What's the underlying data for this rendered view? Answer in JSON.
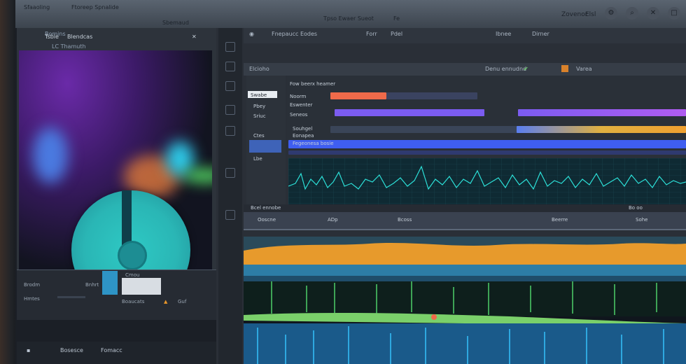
{
  "topbar": {
    "menu1": "Sfaaoling",
    "menu2": "Ftoreep Spnalide",
    "menu3": "Sbemaud",
    "title": "Tpso Ewaer Sueot",
    "menu4": "Fe",
    "right_label": "Zovenor",
    "right_label2": "Elsl"
  },
  "leftwin": {
    "title": "Bomins",
    "tab1": "Tsbie",
    "tab2": "Blendcas",
    "breadcrumb": "LC Thamuth",
    "bottom_labels": [
      "Bosesce",
      "Fomacc"
    ]
  },
  "controls": {
    "row1_label": "Brodm",
    "row1_label2": "Bnhrt",
    "row2_label": "Cmou",
    "row2_label2": "Hmtes",
    "row3_label": "Boaucats",
    "row3_label2": "Guf"
  },
  "editor": {
    "header_left": "Fnepaucc Eodes",
    "header_center": "Forr",
    "header_center2": "Pdel",
    "panel_title": "Elcioho",
    "panel_sub": "Fow beerx heamer",
    "right_tools": [
      "Ibnee",
      "Dirner",
      "Denu ennudnd",
      "Varea"
    ],
    "tracks": [
      "Swabe",
      "Pbey",
      "Sriuc",
      "Ctes",
      "Lbe"
    ],
    "track_labels": [
      "Noorm",
      "Eswenter",
      "Seneos",
      "Souhgel",
      "Eonapea",
      "Fegeonesa bosie"
    ],
    "mid_label": "Bcel ennobe",
    "toolbar": [
      "Ooscne",
      "ADp",
      "Bcoss",
      "Beerre",
      "Sohe"
    ],
    "status": "Bo oo"
  },
  "colors": {
    "accent_orange": "#ef6a4a",
    "accent_purple": "#7b5cf0",
    "accent_blue": "#3f5ef0",
    "wave_teal": "#2ce0d8",
    "wave_orange": "#e79a2c"
  }
}
